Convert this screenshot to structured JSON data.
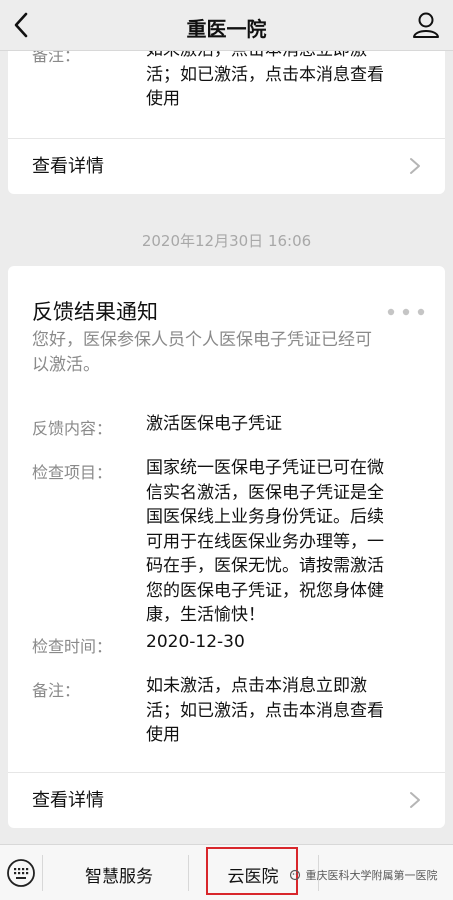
{
  "header": {
    "title": "重医一院"
  },
  "previous_card": {
    "note_lines": [
      "如未激活，点击本消息立即激",
      "活；如已激活，点击本消息查看",
      "使用"
    ],
    "details_label": "查看详情"
  },
  "timestamp": "2020年12月30日 16:06",
  "card": {
    "title": "反馈结果通知",
    "intro_lines": [
      "您好，医保参保人员个人医保电子凭证已经可",
      "以激活。"
    ],
    "fields": [
      {
        "label": "反馈内容：",
        "value_lines": [
          "激活医保电子凭证"
        ]
      },
      {
        "label": "检查项目：",
        "value_lines": [
          "国家统一医保电子凭证已可在微",
          "信实名激活，医保电子凭证是全",
          "国医保线上业务身份凭证。后续",
          "可用于在线医保业务办理等，一",
          "码在手，医保无忧。请按需激活",
          "您的医保电子凭证，祝您身体健",
          "康，生活愉快！"
        ]
      },
      {
        "label": "检查时间：",
        "value_lines": [
          "2020-12-30"
        ]
      },
      {
        "label": "备注：",
        "value_lines": [
          "如未激活，点击本消息立即激",
          "活；如已激活，点击本消息查看",
          "使用"
        ]
      }
    ],
    "details_label": "查看详情"
  },
  "bottom_menu": {
    "items": [
      "智慧服务",
      "云医院",
      "..."
    ],
    "watermark": "重庆医科大学附属第一医院"
  },
  "colors": {
    "background": "#ececec",
    "highlight_box": "#d8262b"
  },
  "icons": {
    "back": "chevron-left-icon",
    "profile": "user-icon",
    "more": "more-dots-icon",
    "chevron": "chevron-right-icon",
    "keyboard": "keyboard-icon"
  }
}
